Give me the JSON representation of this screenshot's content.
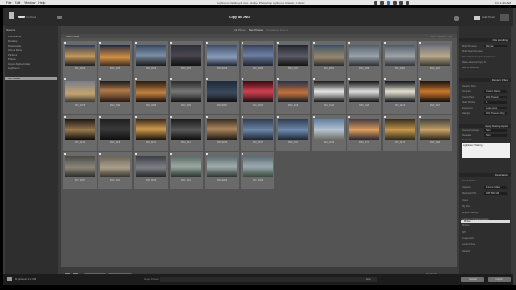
{
  "menubar": {
    "items": [
      "Lightroom",
      "File",
      "Edit",
      "Window",
      "Help"
    ],
    "window_title": "Lightroom Catalog-2.lrcat - Adobe Photoshop Lightroom Classic - Library",
    "clock": "Fri 11:23 AM"
  },
  "identity": {
    "catalog": "Untitled",
    "center_title": "Copy as DNG",
    "center_title_suffix": "Add",
    "right_label": "Add Panel"
  },
  "left_panel": {
    "header": "Source",
    "rows": [
      {
        "label": "Documents"
      },
      {
        "label": "Desktop"
      },
      {
        "label": "Downloads"
      },
      {
        "label": "iCloud Drive"
      },
      {
        "label": "Pictures"
      },
      {
        "label": "Photos"
      },
      {
        "label": "Import Alpha Folder"
      },
      {
        "label": "Lightroom"
      },
      {
        "label": "NO NAME",
        "selected": true
      }
    ]
  },
  "top_header": {
    "tab_all": "All Photos",
    "tab_new": "New Photos",
    "tab_dest": "Destination Folders"
  },
  "grid_header": {
    "left": "New Photos",
    "right": "Sort: Capture Time"
  },
  "grid": {
    "captions": [
      "DSC_0012",
      "DSC_0019",
      "DSC_0026",
      "DSC_0031",
      "DSC_0038",
      "DSC_0042",
      "DSC_0047",
      "DSC_0051",
      "DSC_0058",
      "DSC_0064",
      "DSC_0071",
      "DSC_0075",
      "DSC_0082",
      "DSC_0089",
      "DSC_0093",
      "DSC_0097",
      "DSC_0102",
      "DSC_0108",
      "DSC_0113",
      "DSC_0118",
      "DSC_0123",
      "DSC_0127",
      "DSC_0132",
      "DSC_0138",
      "DSC_0141",
      "DSC_0145",
      "DSC_0152",
      "DSC_0157",
      "DSC_0161",
      "DSC_0166",
      "DSC_0171",
      "DSC_0176",
      "DSC_0182",
      "DSC_0187",
      "DSC_0191",
      "DSC_0195",
      "DSC_0199",
      "DSC_0203",
      "DSC_0208"
    ]
  },
  "bottom_bar": {
    "check_all": "Check All",
    "uncheck_all": "Uncheck All",
    "sort": "Sort: Capture Time",
    "thumbnails": "Thumbnails"
  },
  "right_panel": {
    "sections": [
      "File Handling",
      "Rename Files",
      "Apply During Import",
      "Destination"
    ],
    "file_handling_rows": [
      {
        "label": "Build Previews",
        "value": "Minimal"
      },
      {
        "label": "Build Smart Previews",
        "value": ""
      },
      {
        "label": "Don't Import Suspected Duplicates",
        "value": ""
      },
      {
        "label": "Make a Second Copy To",
        "value": ""
      },
      {
        "label": "Add to Collection",
        "value": ""
      }
    ],
    "rename_rows": [
      {
        "label": "Rename Files",
        "value": ""
      },
      {
        "label": "Template",
        "value": "Custom Name"
      },
      {
        "label": "Custom Text",
        "value": "2019 Travels"
      },
      {
        "label": "Start Number",
        "value": "1"
      },
      {
        "label": "Extensions",
        "value": "Leave as-is"
      },
      {
        "label": "Sample",
        "value": "2019 Travels-1.dng"
      }
    ],
    "apply_rows": [
      {
        "label": "Develop Settings",
        "value": "None"
      },
      {
        "label": "Metadata",
        "value": "None"
      }
    ],
    "keywords_label": "Keywords",
    "keywords": "Lightroom Training",
    "destination_rows": [
      {
        "label": "Into Subfolder",
        "value": ""
      },
      {
        "label": "Organize",
        "value": "Into one folder"
      },
      {
        "label": "Macintosh HD",
        "value": "205 / 500 GB"
      },
      {
        "label": "Users",
        "value": ""
      },
      {
        "label": "My Pics",
        "value": ""
      },
      {
        "label": "English Training",
        "value": ""
      },
      {
        "label": "Lightroom Training Imports",
        "value": ""
      },
      {
        "label": "Photos",
        "value": ""
      },
      {
        "label": "MH",
        "value": ""
      },
      {
        "label": "Image 2019",
        "value": ""
      },
      {
        "label": "Local Archive",
        "value": ""
      },
      {
        "label": "Network",
        "value": ""
      }
    ],
    "highlight_row": "Photos"
  },
  "footer": {
    "label": "39 photos / 2.1 GB",
    "preset_label": "Import Preset",
    "preset_value": "None",
    "cancel": "Cancel",
    "import": "Import"
  },
  "colors": {
    "app_bg": "#3b3b3b",
    "panel_bg": "#2e2e2e",
    "grid_bg": "#545454",
    "cell_bg": "#6a6a6a"
  }
}
